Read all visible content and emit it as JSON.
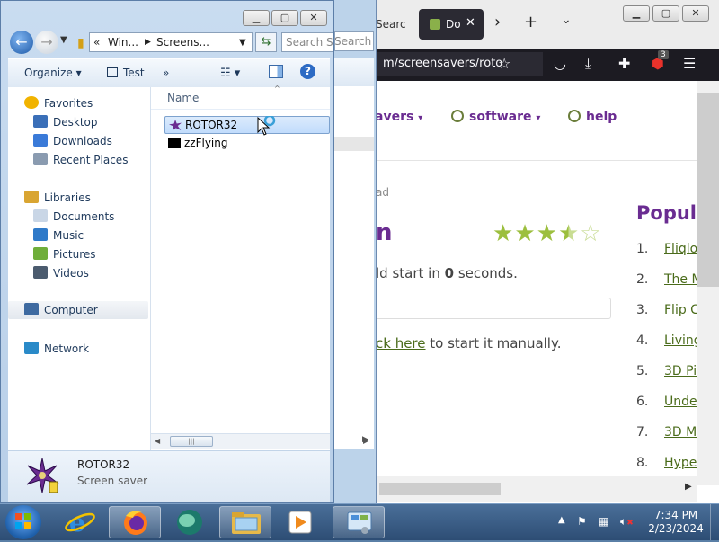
{
  "firefox": {
    "tab_search_label": "Searc",
    "active_tab_label": "Do",
    "url": "m/screensavers/roto",
    "extension_badge": "3",
    "site_nav": [
      {
        "label": "avers"
      },
      {
        "label": "software"
      },
      {
        "label": "help"
      }
    ],
    "breadcrumb": "ad",
    "title_fragment": "n",
    "rating_stars": 3.5,
    "countdown_prefix": "ld start in ",
    "countdown_value": "0",
    "countdown_suffix": " seconds.",
    "manual_link": "ck here",
    "manual_suffix": " to start it manually.",
    "popular_title": "Popula",
    "popular_items": [
      {
        "num": "1.",
        "label": "Fliqlo"
      },
      {
        "num": "2.",
        "label": "The M"
      },
      {
        "num": "3.",
        "label": "Flip C"
      },
      {
        "num": "4.",
        "label": "Living"
      },
      {
        "num": "5.",
        "label": "3D Pip"
      },
      {
        "num": "6.",
        "label": "Under"
      },
      {
        "num": "7.",
        "label": "3D Ma"
      },
      {
        "num": "8.",
        "label": "Hyper"
      }
    ]
  },
  "explorer2": {
    "search_placeholder": "Search R"
  },
  "explorer": {
    "address": {
      "seg1": "Win...",
      "seg2": "Screens..."
    },
    "search_placeholder": "Search S",
    "toolbar": {
      "organize": "Organize",
      "test": "Test",
      "more": "»"
    },
    "nav": [
      {
        "label": "Favorites",
        "icon": "star-icon",
        "group": true
      },
      {
        "label": "Desktop",
        "icon": "desktop-icon"
      },
      {
        "label": "Downloads",
        "icon": "downloads-icon"
      },
      {
        "label": "Recent Places",
        "icon": "recent-places-icon"
      },
      {
        "label": "Libraries",
        "icon": "libraries-icon",
        "group": true
      },
      {
        "label": "Documents",
        "icon": "documents-icon"
      },
      {
        "label": "Music",
        "icon": "music-icon"
      },
      {
        "label": "Pictures",
        "icon": "pictures-icon"
      },
      {
        "label": "Videos",
        "icon": "videos-icon"
      },
      {
        "label": "Computer",
        "icon": "computer-icon",
        "group": true
      },
      {
        "label": "Network",
        "icon": "network-icon",
        "group": true
      }
    ],
    "column_name": "Name",
    "files": [
      {
        "name": "ROTOR32",
        "selected": true
      },
      {
        "name": "zzFlying",
        "selected": false
      }
    ],
    "details": {
      "name": "ROTOR32",
      "type": "Screen saver"
    }
  },
  "taskbar": {
    "time": "7:34 PM",
    "date": "2/23/2024"
  }
}
